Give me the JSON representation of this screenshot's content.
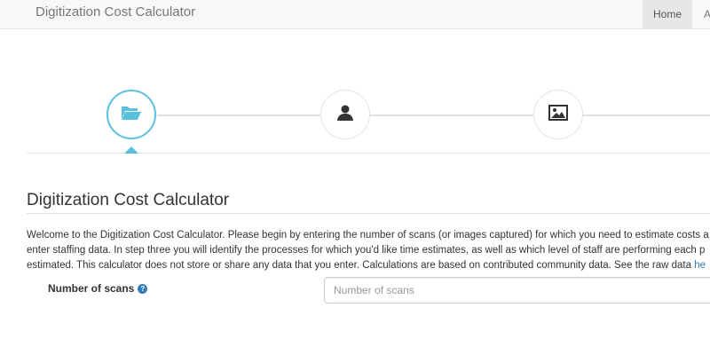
{
  "navbar": {
    "brand": "Digitization Cost Calculator",
    "items": [
      {
        "label": "Home",
        "active": true
      },
      {
        "label": "A",
        "active": false
      }
    ]
  },
  "wizard": {
    "steps": [
      {
        "icon": "folder-open-icon",
        "active": true
      },
      {
        "icon": "user-icon",
        "active": false
      },
      {
        "icon": "picture-icon",
        "active": false
      }
    ],
    "accent_color": "#5bc0de"
  },
  "main": {
    "heading": "Digitization Cost Calculator",
    "intro_lines": [
      "Welcome to the Digitization Cost Calculator. Please begin by entering the number of scans (or images captured) for which you need to estimate costs a",
      "enter staffing data. In step three you will identify the processes for which you'd like time estimates, as well as which level of staff are performing each p",
      "estimated. This calculator does not store or share any data that you enter. Calculations are based on contributed community data. See the raw data "
    ],
    "intro_link": "he",
    "scans_field": {
      "label": "Number of scans",
      "placeholder": "Number of scans",
      "value": ""
    }
  }
}
